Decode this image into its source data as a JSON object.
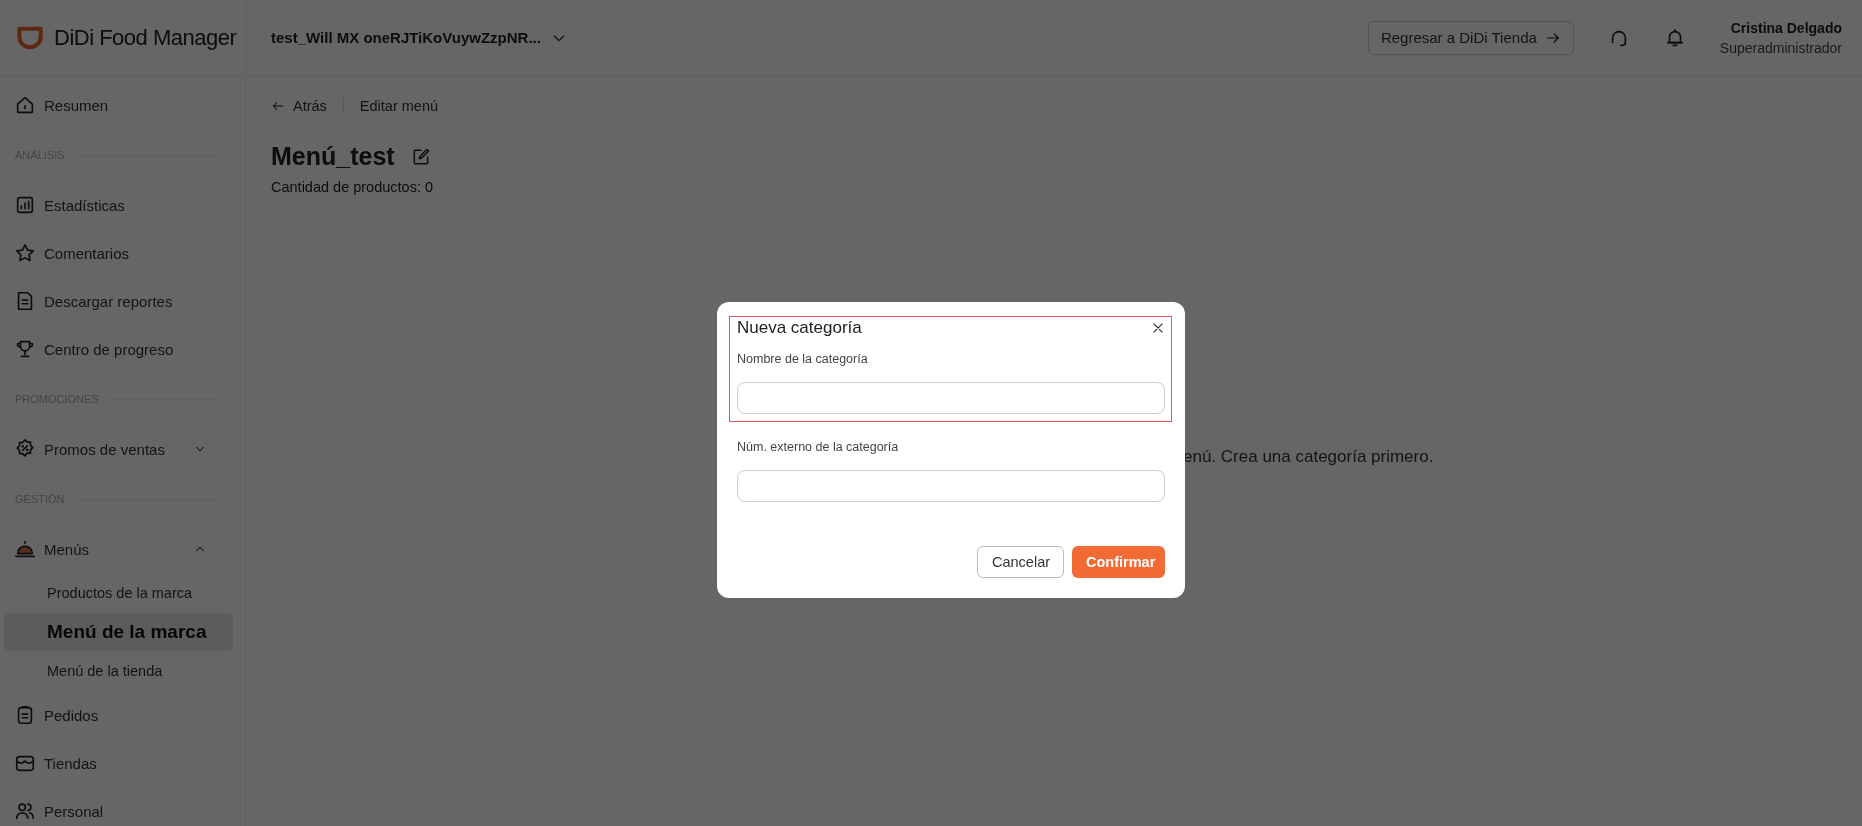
{
  "header": {
    "logo": "DiDi Food Manager",
    "store_selector": "test_Will MX oneRJTiKoVuywZzpNR...",
    "return_button": "Regresar a DiDi Tienda",
    "user": {
      "name": "Cristina Delgado",
      "role": "Superadministrador"
    }
  },
  "sidebar": {
    "items": [
      {
        "kind": "item",
        "label": "Resumen",
        "selected": false
      },
      {
        "kind": "section",
        "label": "ANÁLISIS"
      },
      {
        "kind": "item",
        "label": "Estadísticas",
        "selected": false
      },
      {
        "kind": "item",
        "label": "Comentarios",
        "selected": false
      },
      {
        "kind": "item",
        "label": "Descargar reportes",
        "selected": false
      },
      {
        "kind": "item",
        "label": "Centro de progreso",
        "selected": false
      },
      {
        "kind": "section",
        "label": "PROMOCIONES"
      },
      {
        "kind": "item",
        "label": "Promos de ventas",
        "selected": false,
        "expanded": false
      },
      {
        "kind": "section",
        "label": "GESTIÓN"
      },
      {
        "kind": "item",
        "label": "Menús",
        "selected": false,
        "expanded": true,
        "children": [
          {
            "label": "Productos de la marca",
            "selected": false
          },
          {
            "label": "Menú de la marca",
            "selected": true
          },
          {
            "label": "Menú de la tienda",
            "selected": false
          }
        ]
      },
      {
        "kind": "item",
        "label": "Pedidos",
        "selected": false
      },
      {
        "kind": "item",
        "label": "Tiendas",
        "selected": false
      },
      {
        "kind": "item",
        "label": "Personal",
        "selected": false
      }
    ]
  },
  "main": {
    "back_link": "Atrás",
    "breadcrumb": "Editar menú",
    "title": "Menú_test",
    "product_count": "Cantidad de productos: 0",
    "empty_message": "enú. Crea una categoría primero."
  },
  "dialog": {
    "title": "Nueva categoría",
    "annotation_frame": true,
    "fields": [
      {
        "label": "Nombre de la categoría"
      },
      {
        "label": "Núm. externo de la categoría"
      }
    ],
    "buttons": [
      {
        "label": "Cancelar",
        "kind": "secondary"
      },
      {
        "label": "Confirmar",
        "kind": "primary"
      }
    ]
  }
}
